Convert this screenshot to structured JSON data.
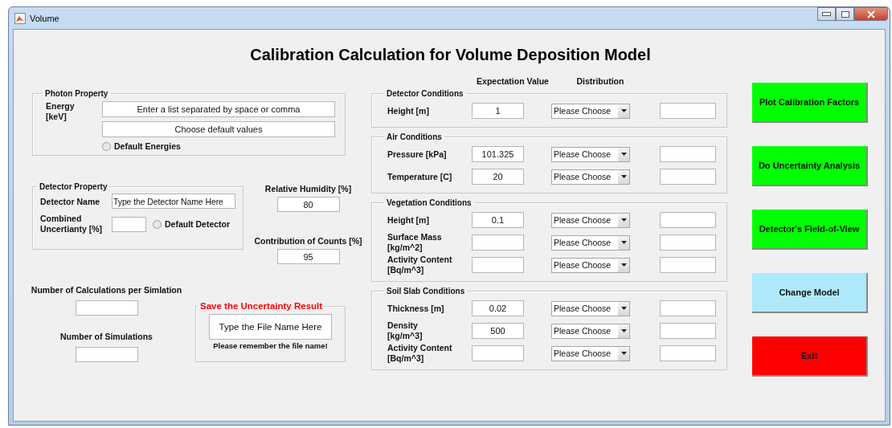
{
  "window": {
    "title": "Volume"
  },
  "heading": "Calibration Calculation for Volume Deposition Model",
  "photon_property": {
    "title": "Photon Property",
    "energy_label": "Energy\n[keV]",
    "energy_list": "Enter a list separated by space or comma",
    "default_values": "Choose default values",
    "default_energies": {
      "label": "Default Energies",
      "checked": false
    }
  },
  "detector_property": {
    "title": "Detector Property",
    "name_label": "Detector Name",
    "name_value": "Type the Detector Name Here",
    "uncertainty_label": "Combined\nUncertianty [%]",
    "default_detector": {
      "label": "Default Detector",
      "checked": false
    }
  },
  "relative_humidity": {
    "label": "Relative Humidity [%]",
    "value": "80"
  },
  "contribution_of_counts": {
    "label": "Contribution of Counts [%]",
    "value": "95"
  },
  "calculations_per_simulation": {
    "label": "Number of Calculations per Simlation"
  },
  "number_of_simulations": {
    "label": "Number of Simulations"
  },
  "save_result": {
    "title": "Save the Uncertainty Result",
    "file_name": "Type the File Name Here",
    "note": "Please remember the file name!"
  },
  "column_headers": {
    "expectation_value": "Expectation Value",
    "distribution": "Distribution"
  },
  "condition_groups": [
    {
      "title": "Detector Conditions",
      "rows": [
        {
          "label": "Height [m]",
          "value": "1",
          "distribution": "Please Choose"
        }
      ]
    },
    {
      "title": "Air Conditions",
      "rows": [
        {
          "label": "Pressure [kPa]",
          "value": "101.325",
          "distribution": "Please Choose"
        },
        {
          "label": "Temperature [C]",
          "value": "20",
          "distribution": "Please Choose"
        }
      ]
    },
    {
      "title": "Vegetation Conditions",
      "rows": [
        {
          "label": "Height [m]",
          "value": "0.1",
          "distribution": "Please Choose"
        },
        {
          "label": "Surface Mass\n[kg/m^2]",
          "distribution": "Please Choose"
        },
        {
          "label": "Activity Content\n[Bq/m^3]",
          "distribution": "Please Choose"
        }
      ]
    },
    {
      "title": "Soil Slab Conditions",
      "rows": [
        {
          "label": "Thickness [m]",
          "value": "0.02",
          "distribution": "Please Choose"
        },
        {
          "label": "Density\n[kg/m^3]",
          "value": "500",
          "distribution": "Please Choose"
        },
        {
          "label": "Activity Content\n[Bq/m^3]",
          "distribution": "Please Choose"
        }
      ]
    }
  ],
  "buttons": [
    {
      "label": "Plot Calibration Factors",
      "color": "#00ff00"
    },
    {
      "label": "Do Uncertainty Analysis",
      "color": "#00ff00"
    },
    {
      "label": "Detector's Field-of-View",
      "color": "#00ff00"
    },
    {
      "label": "Change Model",
      "color": "#aeeafc"
    },
    {
      "label": "Exit",
      "color": "#ff0000"
    }
  ]
}
